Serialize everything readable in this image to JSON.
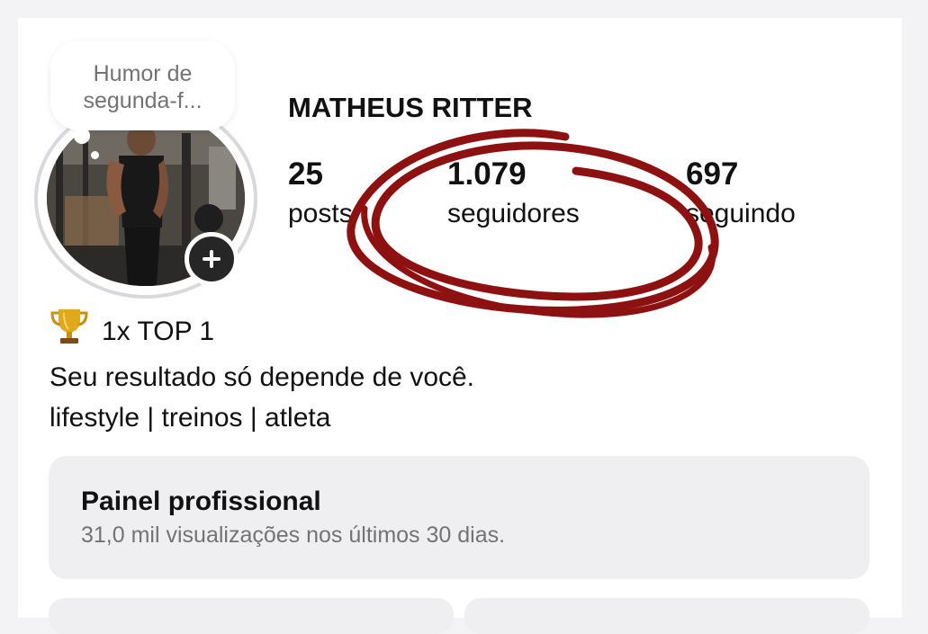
{
  "note": {
    "text": "Humor de segunda-f..."
  },
  "profile": {
    "name": "MATHEUS RITTER",
    "add_icon": "plus-icon",
    "stats": [
      {
        "value": "25",
        "label": "posts"
      },
      {
        "value": "1.079",
        "label": "seguidores"
      },
      {
        "value": "697",
        "label": "seguindo"
      }
    ]
  },
  "bio": {
    "badge_icon": "trophy-icon",
    "badge_text": "1x TOP 1",
    "line1": "Seu resultado só depende de você.",
    "line2": "lifestyle | treinos | atleta"
  },
  "panel": {
    "title": "Painel profissional",
    "subtitle": "31,0 mil visualizações nos últimos 30 dias."
  },
  "colors": {
    "annotation": "#8e1111",
    "secondary_text": "#737373",
    "panel_bg": "#efeff1"
  }
}
